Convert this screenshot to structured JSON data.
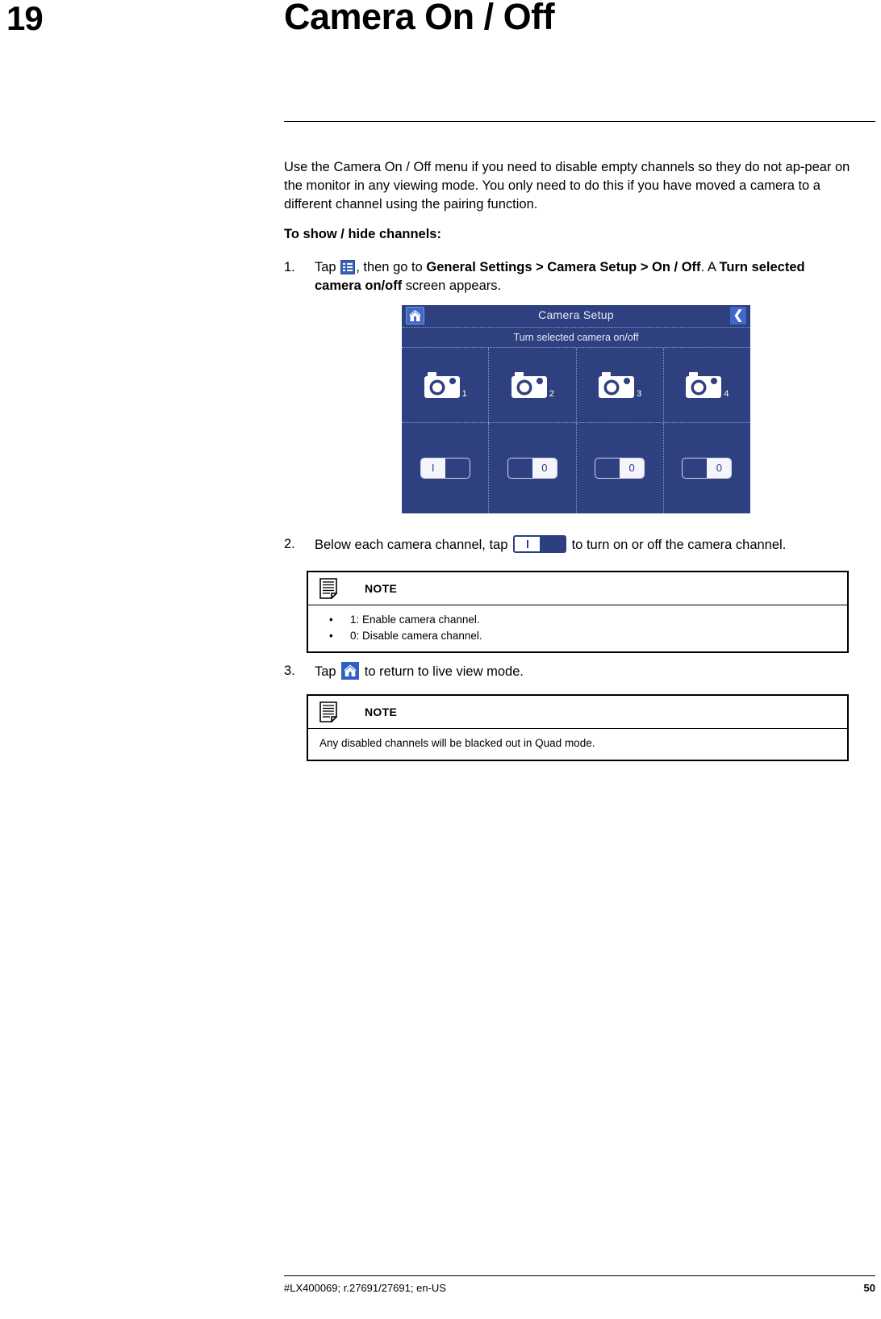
{
  "page": {
    "chapter_number": "19",
    "chapter_title": "Camera On / Off"
  },
  "intro": {
    "paragraph": "Use the Camera On / Off menu if you need to disable empty channels so they do not ap-pear on the monitor in any viewing mode. You only need to do this if you have moved a camera to a different channel using the pairing function.",
    "subhead": "To show / hide channels:"
  },
  "steps": [
    {
      "number": "1.",
      "part1": "Tap",
      "icon": "menu-icon",
      "part2": ", then go to",
      "bold1": "General Settings > Camera Setup > On / Off",
      "part3": ". A",
      "bold2": "Turn selected camera on/off",
      "part4": "screen appears."
    },
    {
      "number": "2.",
      "part1": "Below each camera channel, tap",
      "icon": "toggle-switch-icon",
      "part2": "to turn on or off the camera channel."
    },
    {
      "number": "3.",
      "part1": "Tap",
      "icon": "home-icon",
      "part2": "to return to live view mode."
    }
  ],
  "device_screenshot": {
    "home_icon": "home-icon",
    "back_icon": "chevron-left-icon",
    "title": "Camera Setup",
    "subtitle": "Turn selected camera on/off",
    "channels": [
      {
        "label": "1",
        "icon": "camera-icon",
        "switch_state": "on",
        "switch_label": "I"
      },
      {
        "label": "2",
        "icon": "camera-icon",
        "switch_state": "off",
        "switch_label": "0"
      },
      {
        "label": "3",
        "icon": "camera-icon",
        "switch_state": "off",
        "switch_label": "0"
      },
      {
        "label": "4",
        "icon": "camera-icon",
        "switch_state": "off",
        "switch_label": "0"
      }
    ]
  },
  "notes": [
    {
      "icon": "note-document-icon",
      "label": "NOTE",
      "bullets": [
        "1: Enable camera channel.",
        "0: Disable camera channel."
      ]
    },
    {
      "icon": "note-document-icon",
      "label": "NOTE",
      "text": "Any disabled channels will be blacked out in Quad mode."
    }
  ],
  "footer": {
    "left": "#LX400069; r.27691/27691; en-US",
    "right": "50"
  },
  "colors": {
    "device_bg": "#2e4080",
    "device_accent": "#3f68c9",
    "icon_blue": "#2f5fc4"
  }
}
